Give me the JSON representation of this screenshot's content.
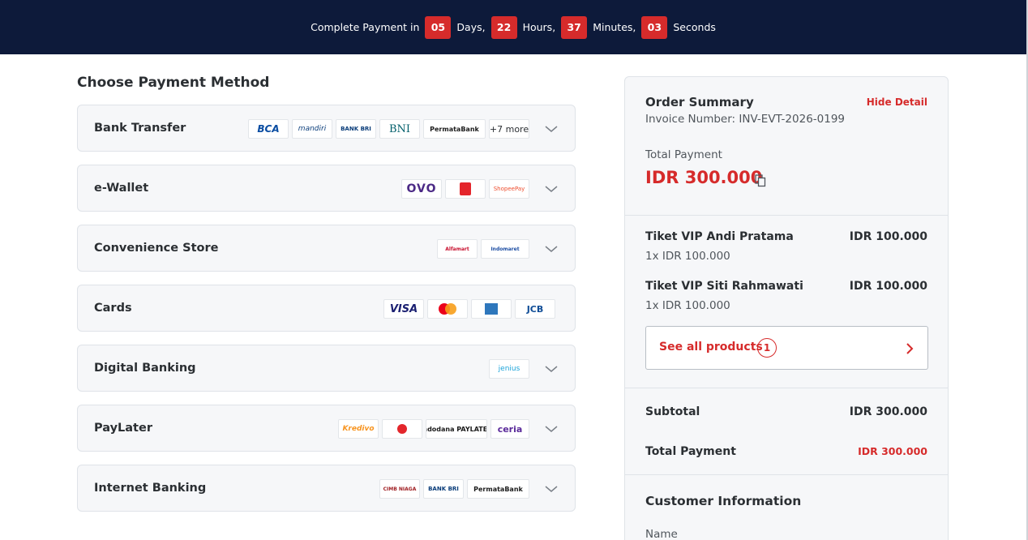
{
  "countdown": {
    "prefix": "Complete Payment in",
    "days": "05",
    "days_label": "Days,",
    "hours": "22",
    "hours_label": "Hours,",
    "minutes": "37",
    "minutes_label": "Minutes,",
    "seconds": "03",
    "seconds_label": "Seconds"
  },
  "payment": {
    "title": "Choose Payment Method",
    "methods": [
      {
        "name": "Bank Transfer",
        "logos": [
          "BCA",
          "mandiri",
          "BANK BRI",
          "BNI",
          "PermataBank",
          "+7 more"
        ]
      },
      {
        "name": "e-Wallet",
        "logos": [
          "OVO",
          "LinkAja",
          "ShopeePay"
        ]
      },
      {
        "name": "Convenience Store",
        "logos": [
          "Alfamart",
          "Indomaret"
        ]
      },
      {
        "name": "Cards",
        "logos": [
          "VISA",
          "mastercard",
          "AMEX",
          "JCB"
        ]
      },
      {
        "name": "Digital Banking",
        "logos": [
          "jenius"
        ]
      },
      {
        "name": "PayLater",
        "logos": [
          "Kredivo",
          "Akulaku",
          "indodana PAYLATER",
          "ceria"
        ]
      },
      {
        "name": "Internet Banking",
        "logos": [
          "CIMB NIAGA",
          "BANK BRI",
          "PermataBank"
        ]
      }
    ]
  },
  "summary": {
    "title": "Order Summary",
    "hide_label": "Hide Detail",
    "invoice": "Invoice Number: INV-EVT-2026-0199",
    "total_label": "Total Payment",
    "total_amount": "IDR 300.000",
    "items": [
      {
        "name": "Tiket VIP Andi Pratama",
        "price": "IDR 100.000",
        "qty": "1x IDR 100.000"
      },
      {
        "name": "Tiket VIP Siti Rahmawati",
        "price": "IDR 100.000",
        "qty": "1x IDR 100.000"
      }
    ],
    "see_all_label": "See all products",
    "see_all_count": "1",
    "subtotal_label": "Subtotal",
    "subtotal_value": "IDR 300.000",
    "total_row_label": "Total Payment",
    "total_row_value": "IDR 300.000",
    "customer_title": "Customer Information",
    "customer_name_label": "Name"
  },
  "colors": {
    "header_bg": "#0d1a3a",
    "accent_red": "#d62b2b",
    "panel_bg": "#f6f7f9"
  }
}
